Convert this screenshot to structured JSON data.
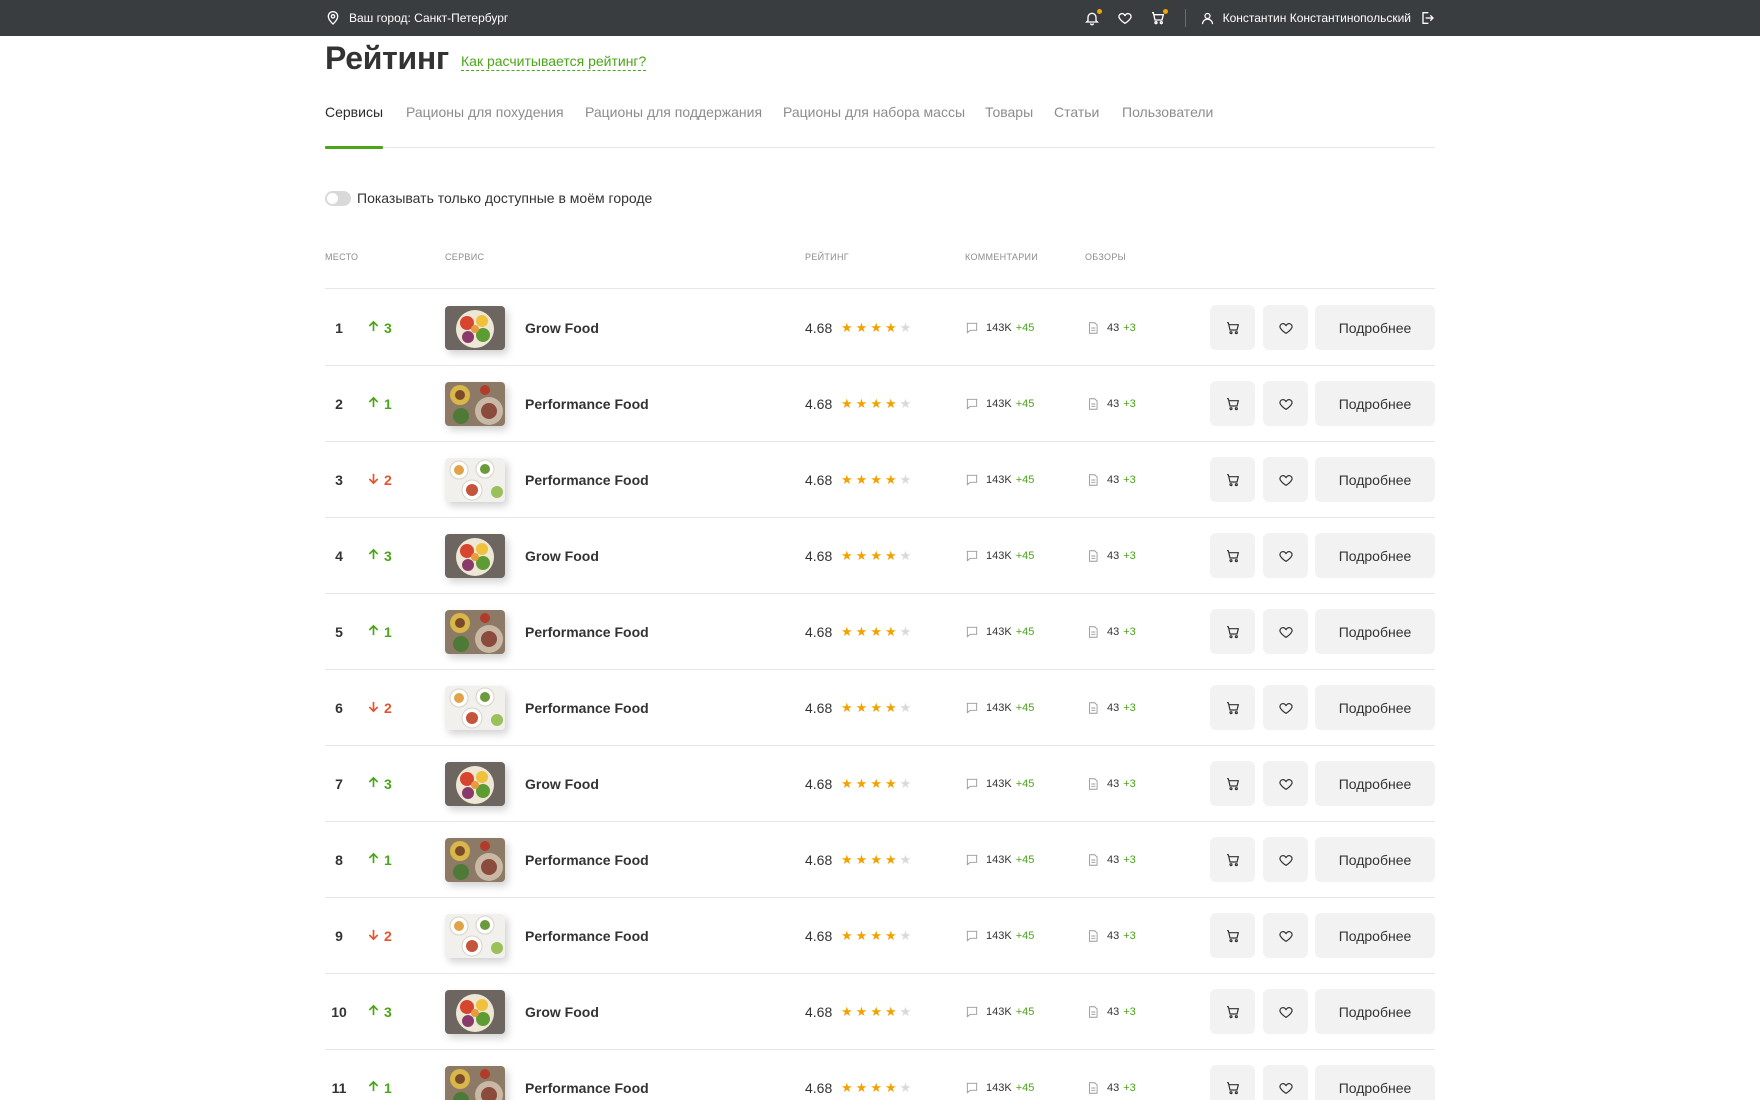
{
  "topbar": {
    "city_label": "Ваш город: Санкт-Петербург",
    "user_name": "Константин Константинопольский",
    "accent": "#f0a500"
  },
  "header": {
    "title": "Рейтинг",
    "how_link": "Как расчитывается рейтинг?"
  },
  "tabs": [
    {
      "label": "Сервисы",
      "active": true
    },
    {
      "label": "Рационы для похудения",
      "active": false
    },
    {
      "label": "Рационы для поддержания",
      "active": false
    },
    {
      "label": "Рационы для набора массы",
      "active": false
    },
    {
      "label": "Товары",
      "active": false
    },
    {
      "label": "Статьи",
      "active": false
    },
    {
      "label": "Пользователи",
      "active": false
    }
  ],
  "filter": {
    "toggle_label": "Показывать только доступные в моём городе",
    "toggle_on": false
  },
  "table": {
    "headers": {
      "place": "Место",
      "service": "Сервис",
      "rating": "Рейтинг",
      "comments": "Комментарии",
      "reviews": "Обзоры"
    },
    "rows": [
      {
        "place": "1",
        "trend": "up",
        "change": "3",
        "name": "Grow Food",
        "image": "bowl",
        "rating": "4.68",
        "stars": 4,
        "comments": "143K",
        "comments_delta": "+45",
        "reviews": "43",
        "reviews_delta": "+3",
        "more_label": "Подробнее"
      },
      {
        "place": "2",
        "trend": "up",
        "change": "1",
        "name": "Performance Food",
        "image": "plates",
        "rating": "4.68",
        "stars": 4,
        "comments": "143K",
        "comments_delta": "+45",
        "reviews": "43",
        "reviews_delta": "+3",
        "more_label": "Подробнее"
      },
      {
        "place": "3",
        "trend": "down",
        "change": "2",
        "name": "Performance Food",
        "image": "table",
        "rating": "4.68",
        "stars": 4,
        "comments": "143K",
        "comments_delta": "+45",
        "reviews": "43",
        "reviews_delta": "+3",
        "more_label": "Подробнее"
      },
      {
        "place": "4",
        "trend": "up",
        "change": "3",
        "name": "Grow Food",
        "image": "bowl",
        "rating": "4.68",
        "stars": 4,
        "comments": "143K",
        "comments_delta": "+45",
        "reviews": "43",
        "reviews_delta": "+3",
        "more_label": "Подробнее"
      },
      {
        "place": "5",
        "trend": "up",
        "change": "1",
        "name": "Performance Food",
        "image": "plates",
        "rating": "4.68",
        "stars": 4,
        "comments": "143K",
        "comments_delta": "+45",
        "reviews": "43",
        "reviews_delta": "+3",
        "more_label": "Подробнее"
      },
      {
        "place": "6",
        "trend": "down",
        "change": "2",
        "name": "Performance Food",
        "image": "table",
        "rating": "4.68",
        "stars": 4,
        "comments": "143K",
        "comments_delta": "+45",
        "reviews": "43",
        "reviews_delta": "+3",
        "more_label": "Подробнее"
      },
      {
        "place": "7",
        "trend": "up",
        "change": "3",
        "name": "Grow Food",
        "image": "bowl",
        "rating": "4.68",
        "stars": 4,
        "comments": "143K",
        "comments_delta": "+45",
        "reviews": "43",
        "reviews_delta": "+3",
        "more_label": "Подробнее"
      },
      {
        "place": "8",
        "trend": "up",
        "change": "1",
        "name": "Performance Food",
        "image": "plates",
        "rating": "4.68",
        "stars": 4,
        "comments": "143K",
        "comments_delta": "+45",
        "reviews": "43",
        "reviews_delta": "+3",
        "more_label": "Подробнее"
      },
      {
        "place": "9",
        "trend": "down",
        "change": "2",
        "name": "Performance Food",
        "image": "table",
        "rating": "4.68",
        "stars": 4,
        "comments": "143K",
        "comments_delta": "+45",
        "reviews": "43",
        "reviews_delta": "+3",
        "more_label": "Подробнее"
      },
      {
        "place": "10",
        "trend": "up",
        "change": "3",
        "name": "Grow Food",
        "image": "bowl",
        "rating": "4.68",
        "stars": 4,
        "comments": "143K",
        "comments_delta": "+45",
        "reviews": "43",
        "reviews_delta": "+3",
        "more_label": "Подробнее"
      },
      {
        "place": "11",
        "trend": "up",
        "change": "1",
        "name": "Performance Food",
        "image": "plates",
        "rating": "4.68",
        "stars": 4,
        "comments": "143K",
        "comments_delta": "+45",
        "reviews": "43",
        "reviews_delta": "+3",
        "more_label": "Подробнее"
      }
    ]
  },
  "colors": {
    "accent_green": "#4aa616",
    "trend_down": "#e3532d",
    "star": "#f2a200",
    "topbar_bg": "#3a3d40"
  }
}
